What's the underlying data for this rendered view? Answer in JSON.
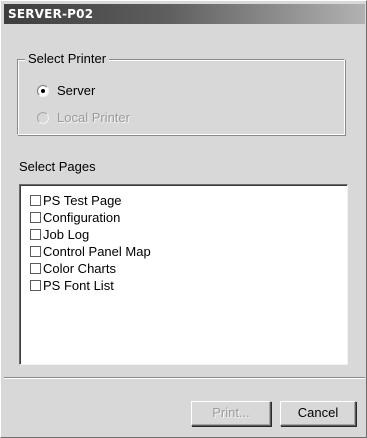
{
  "window": {
    "title": "SERVER-P02"
  },
  "select_printer": {
    "label": "Select Printer",
    "options": [
      {
        "label": "Server",
        "selected": true,
        "enabled": true
      },
      {
        "label": "Local Printer",
        "selected": false,
        "enabled": false
      }
    ]
  },
  "select_pages": {
    "label": "Select Pages",
    "items": [
      {
        "label": "PS Test Page",
        "checked": false
      },
      {
        "label": "Configuration",
        "checked": false
      },
      {
        "label": "Job Log",
        "checked": false
      },
      {
        "label": "Control Panel Map",
        "checked": false
      },
      {
        "label": "Color Charts",
        "checked": false
      },
      {
        "label": "PS Font List",
        "checked": false
      }
    ]
  },
  "buttons": {
    "print_label": "Print...",
    "print_enabled": false,
    "cancel_label": "Cancel"
  }
}
